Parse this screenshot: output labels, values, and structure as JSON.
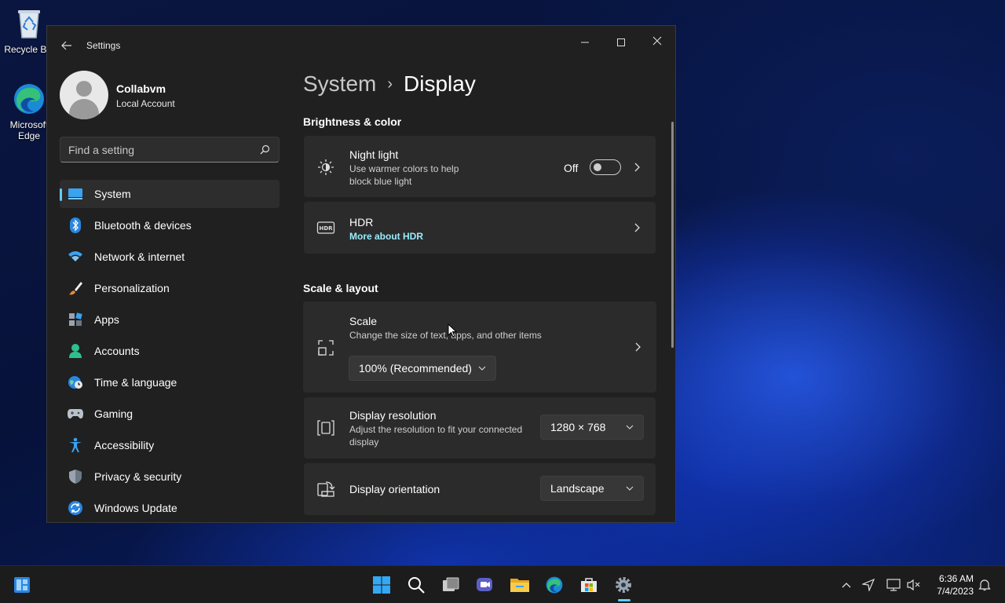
{
  "desktop": {
    "icons": [
      {
        "label": "Recycle Bin",
        "icon": "recycle-bin-icon"
      },
      {
        "label": "Microsoft Edge",
        "icon": "edge-icon"
      }
    ]
  },
  "window": {
    "title": "Settings",
    "controls": {
      "minimize": "minimize-icon",
      "maximize": "maximize-icon",
      "close": "close-icon"
    }
  },
  "profile": {
    "name": "Collabvm",
    "account_type": "Local Account"
  },
  "search": {
    "placeholder": "Find a setting"
  },
  "sidebar": {
    "items": [
      {
        "label": "System",
        "icon": "system-icon",
        "active": true
      },
      {
        "label": "Bluetooth & devices",
        "icon": "bluetooth-icon"
      },
      {
        "label": "Network & internet",
        "icon": "wifi-icon"
      },
      {
        "label": "Personalization",
        "icon": "brush-icon"
      },
      {
        "label": "Apps",
        "icon": "apps-icon"
      },
      {
        "label": "Accounts",
        "icon": "accounts-icon"
      },
      {
        "label": "Time & language",
        "icon": "globe-clock-icon"
      },
      {
        "label": "Gaming",
        "icon": "controller-icon"
      },
      {
        "label": "Accessibility",
        "icon": "accessibility-icon"
      },
      {
        "label": "Privacy & security",
        "icon": "shield-icon"
      },
      {
        "label": "Windows Update",
        "icon": "update-icon"
      }
    ]
  },
  "main": {
    "breadcrumb": {
      "parent": "System",
      "separator": "›",
      "current": "Display"
    },
    "sections": {
      "brightness": {
        "title": "Brightness & color",
        "night_light": {
          "title": "Night light",
          "description": "Use warmer colors to help block blue light",
          "state": "Off",
          "enabled": false
        },
        "hdr": {
          "title": "HDR",
          "link": "More about HDR"
        }
      },
      "scale_layout": {
        "title": "Scale & layout",
        "scale": {
          "title": "Scale",
          "description": "Change the size of text, apps, and other items",
          "value": "100% (Recommended)"
        },
        "resolution": {
          "title": "Display resolution",
          "description": "Adjust the resolution to fit your connected display",
          "value": "1280 × 768"
        },
        "orientation": {
          "title": "Display orientation",
          "value": "Landscape"
        }
      }
    }
  },
  "taskbar": {
    "apps": [
      "start-icon",
      "search-icon",
      "task-view-icon",
      "chat-icon",
      "file-explorer-icon",
      "edge-icon",
      "store-icon",
      "settings-icon"
    ],
    "active_app": "settings-icon",
    "tray": [
      "chevron-up-icon",
      "location-icon",
      "network-icon",
      "volume-muted-icon",
      "notification-icon"
    ],
    "clock": {
      "time": "6:36 AM",
      "date": "7/4/2023"
    }
  },
  "colors": {
    "accent": "#60cdff",
    "link": "#99ebff",
    "window_bg": "#202020",
    "card_bg": "#2b2b2b"
  }
}
